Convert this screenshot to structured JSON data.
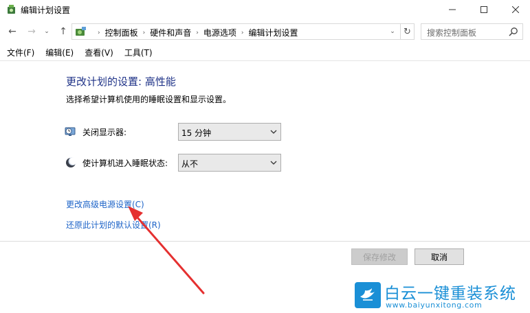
{
  "window": {
    "title": "编辑计划设置",
    "controls": {
      "minimize": "–",
      "maximize": "☐",
      "close": "✕"
    },
    "icon": "power-options-icon"
  },
  "nav": {
    "back": "←",
    "forward": "→",
    "recent": "⌄",
    "up": "↑",
    "breadcrumbs": [
      "控制面板",
      "硬件和声音",
      "电源选项",
      "编辑计划设置"
    ],
    "breadcrumb_separator": "›",
    "dropdown": "⌄",
    "refresh": "↻",
    "search_placeholder": "搜索控制面板"
  },
  "menu": {
    "items": [
      "文件(F)",
      "编辑(E)",
      "查看(V)",
      "工具(T)"
    ]
  },
  "main": {
    "title": "更改计划的设置: 高性能",
    "description": "选择希望计算机使用的睡眠设置和显示设置。",
    "settings": [
      {
        "label": "关闭显示器:",
        "value": "15 分钟",
        "icon": "monitor-clock-icon"
      },
      {
        "label": "使计算机进入睡眠状态:",
        "value": "从不",
        "icon": "moon-sleep-icon"
      }
    ],
    "links": {
      "advanced": "更改高级电源设置(C)",
      "restore": "还原此计划的默认设置(R)"
    },
    "buttons": {
      "save": "保存修改",
      "cancel": "取消"
    }
  },
  "watermark": {
    "title": "白云一键重装系统",
    "url": "www.baiyunxitong.com"
  },
  "colors": {
    "title_blue": "#1e3287",
    "link_blue": "#1e64c8",
    "annotation_red": "#e53030",
    "watermark_blue": "#1a8fd6"
  }
}
